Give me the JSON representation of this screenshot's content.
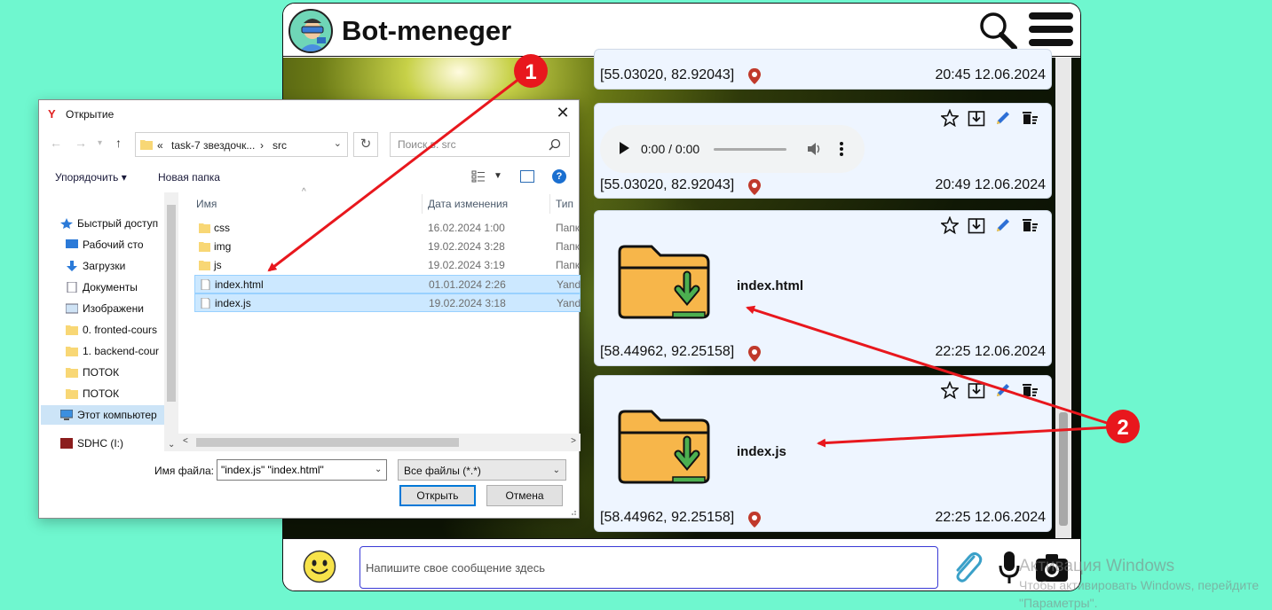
{
  "app": {
    "title": "Bot-meneger",
    "messages": [
      {
        "coords": "[55.03020, 82.92043]",
        "time": "20:45 12.06.2024"
      },
      {
        "coords": "[55.03020, 82.92043]",
        "time": "20:49 12.06.2024",
        "audio_time": "0:00 / 0:00"
      },
      {
        "coords": "[58.44962, 92.25158]",
        "time": "22:25 12.06.2024",
        "file_name": "index.html"
      },
      {
        "coords": "[58.44962, 92.25158]",
        "time": "22:25 12.06.2024",
        "file_name": "index.js"
      }
    ],
    "composer": {
      "placeholder": "Напишите свое сообщение здесь"
    }
  },
  "dialog": {
    "title": "Открытие",
    "breadcrumb": [
      "«",
      "task-7 звездочк...",
      "›",
      "src"
    ],
    "search_placeholder": "Поиск в: src",
    "toolbar": {
      "organize": "Упорядочить ▾",
      "new_folder": "Новая папка"
    },
    "nav_items": [
      {
        "label": "Быстрый доступ"
      },
      {
        "label": "Рабочий сто"
      },
      {
        "label": "Загрузки"
      },
      {
        "label": "Документы"
      },
      {
        "label": "Изображени"
      },
      {
        "label": "0. fronted-cours"
      },
      {
        "label": "1. backend-cour"
      },
      {
        "label": "ПОТОК"
      },
      {
        "label": "ПОТОК"
      },
      {
        "label": "Этот компьютер"
      },
      {
        "label": "SDHC (I:)"
      }
    ],
    "columns": {
      "name": "Имя",
      "date": "Дата изменения",
      "type": "Тип"
    },
    "files": [
      {
        "name": "css",
        "date": "16.02.2024 1:00",
        "type": "Папк",
        "kind": "folder",
        "selected": false
      },
      {
        "name": "img",
        "date": "19.02.2024 3:28",
        "type": "Папк",
        "kind": "folder",
        "selected": false
      },
      {
        "name": "js",
        "date": "19.02.2024 3:19",
        "type": "Папк",
        "kind": "folder",
        "selected": false
      },
      {
        "name": "index.html",
        "date": "01.01.2024 2:26",
        "type": "Yand",
        "kind": "file",
        "selected": true
      },
      {
        "name": "index.js",
        "date": "19.02.2024 3:18",
        "type": "Yand",
        "kind": "file",
        "selected": true
      }
    ],
    "filename_label": "Имя файла:",
    "filename_value": "\"index.js\" \"index.html\"",
    "filetype": "Все файлы (*.*)",
    "open_button": "Открыть",
    "cancel_button": "Отмена"
  },
  "annotations": {
    "badge_1": "1",
    "badge_2": "2",
    "color": "#e8171d"
  },
  "watermark": {
    "line1": "Активация Windows",
    "line2": "Чтобы активировать Windows, перейдите",
    "line3": "\"Параметры\"."
  }
}
